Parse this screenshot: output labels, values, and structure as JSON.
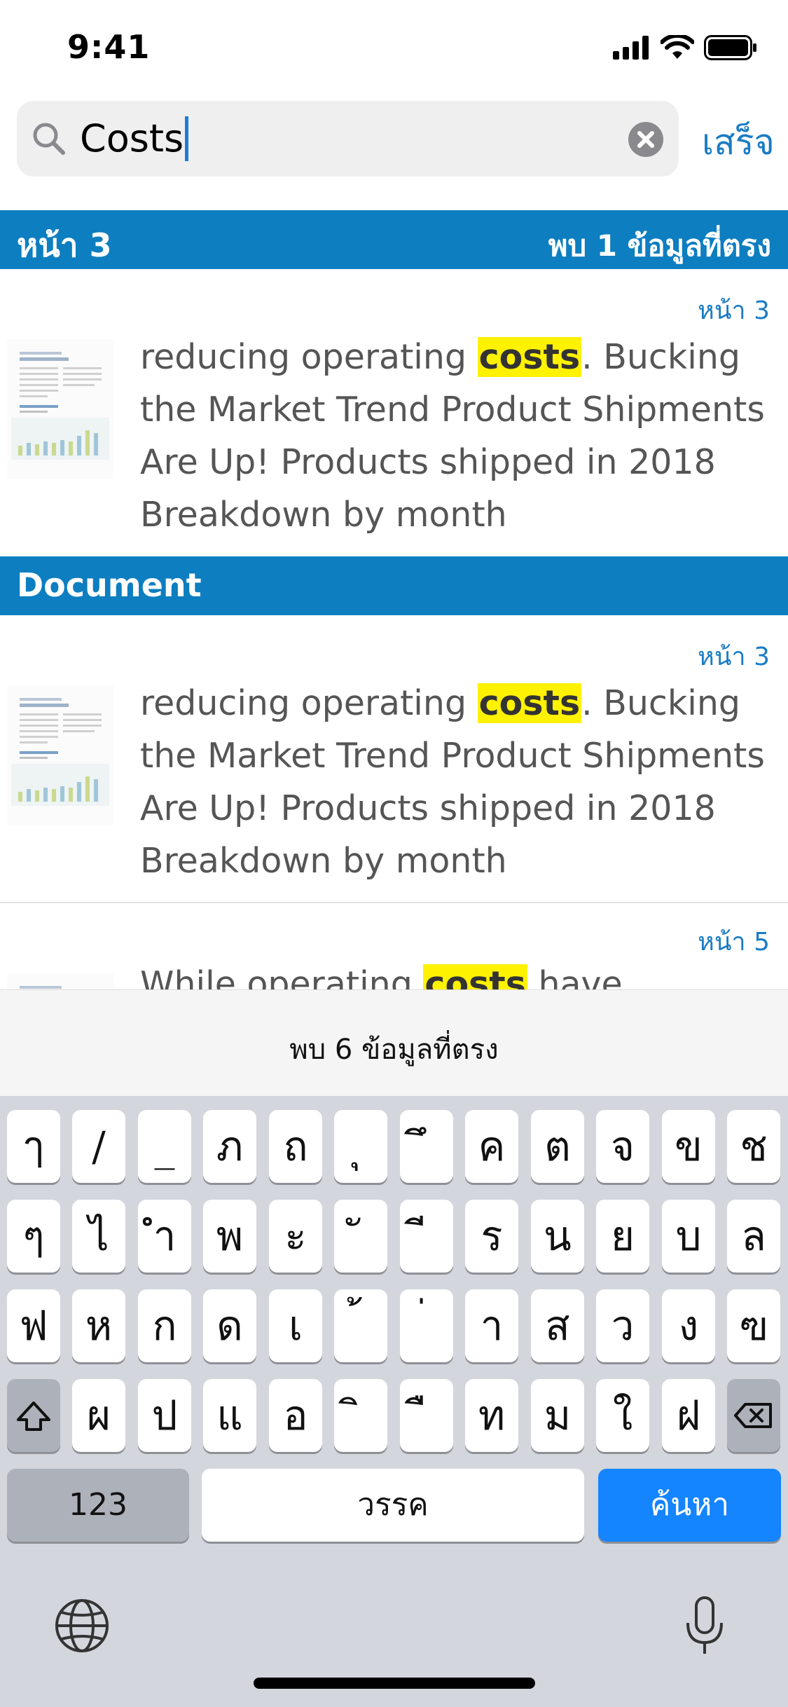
{
  "status": {
    "time": "9:41"
  },
  "search": {
    "value": "Costs",
    "done_label": "เสร็จ"
  },
  "sections": [
    {
      "left": "หน้า 3",
      "right": "พบ 1 ข้อมูลที่ตรง"
    },
    {
      "left": "Document",
      "right": ""
    }
  ],
  "results": [
    {
      "page": "หน้า 3",
      "before": "reducing operating ",
      "match": "costs",
      "after": ". Bucking the Market Trend Product Shipments Are Up! Products shipped in 2018 Breakdown by month"
    },
    {
      "page": "หน้า 3",
      "before": "reducing operating ",
      "match": "costs",
      "after": ". Bucking the Market Trend Product Shipments Are Up! Products shipped in 2018 Breakdown by month"
    },
    {
      "page": "หน้า 5",
      "before": "While operating ",
      "match": "costs",
      "after": " have increased"
    }
  ],
  "match_count": "พบ 6 ข้อมูลที่ตรง",
  "keyboard": {
    "row1": [
      "ๅ",
      "/",
      "_",
      "ภ",
      "ถ",
      "ุ",
      "ึ",
      "ค",
      "ต",
      "จ",
      "ข",
      "ช"
    ],
    "row2": [
      "ๆ",
      "ไ",
      "ำ",
      "พ",
      "ะ",
      "ั",
      "ี",
      "ร",
      "น",
      "ย",
      "บ",
      "ล"
    ],
    "row3": [
      "ฟ",
      "ห",
      "ก",
      "ด",
      "เ",
      "้",
      "่",
      "า",
      "ส",
      "ว",
      "ง",
      "ฃ"
    ],
    "row4": [
      "ผ",
      "ป",
      "แ",
      "อ",
      "ิ",
      "ื",
      "ท",
      "ม",
      "ใ",
      "ฝ"
    ],
    "numbers_label": "123",
    "space_label": "วรรค",
    "search_label": "ค้นหา"
  },
  "icons": [
    "search-icon",
    "clear-icon",
    "shift-icon",
    "backspace-icon",
    "globe-icon",
    "microphone-icon",
    "signal-icon",
    "wifi-icon",
    "battery-icon"
  ]
}
